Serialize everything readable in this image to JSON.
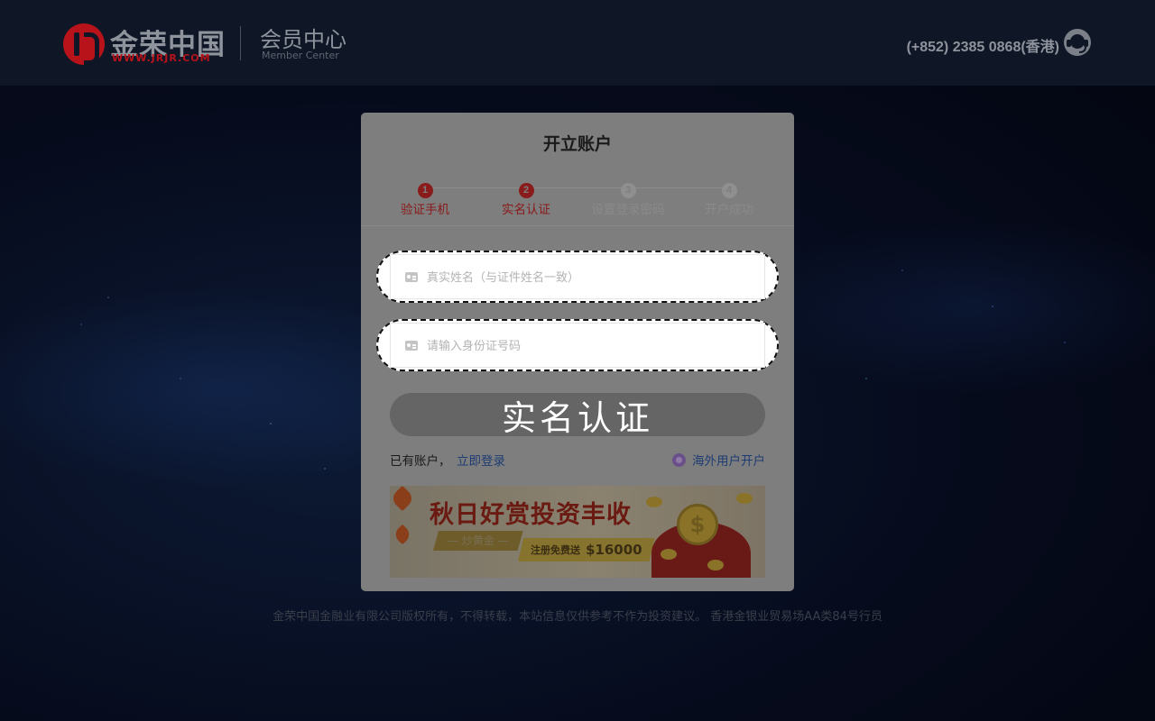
{
  "header": {
    "logo_text": "金荣中国",
    "logo_url": "WWW.JRJR.COM",
    "member_center_cn": "会员中心",
    "member_center_en": "Member Center",
    "phone": "(+852) 2385 0868(香港)",
    "support_icon": "headset-icon"
  },
  "form": {
    "title": "开立账户",
    "steps": [
      {
        "num": "1",
        "label": "验证手机",
        "state": "done"
      },
      {
        "num": "2",
        "label": "实名认证",
        "state": "current"
      },
      {
        "num": "3",
        "label": "设置登录密码",
        "state": "pending"
      },
      {
        "num": "4",
        "label": "开户成功",
        "state": "pending"
      }
    ],
    "name_field": {
      "placeholder": "真实姓名（与证件姓名一致）",
      "value": "",
      "icon": "id-card-icon"
    },
    "id_field": {
      "placeholder": "请输入身份证号码",
      "value": "",
      "icon": "id-card-icon"
    },
    "submit_label": "实名认证",
    "have_account": "已有账户，",
    "login_link": "立即登录",
    "overseas_link": "海外用户开户",
    "overseas_icon": "globe-icon"
  },
  "banner": {
    "title": "秋日好赏投资丰收",
    "tag": "— 炒黄金 —",
    "promo_small": "注册免费送",
    "promo_big": "$16000",
    "coin_symbol": "$"
  },
  "footer": {
    "text": "金荣中国金融业有限公司版权所有，不得转载，本站信息仅供参考不作为投资建议。 香港金银业贸易场AA类84号行员"
  },
  "colors": {
    "accent_red": "#b8131b",
    "link_blue": "#1e3c73",
    "header_bg": "#0f1626"
  }
}
